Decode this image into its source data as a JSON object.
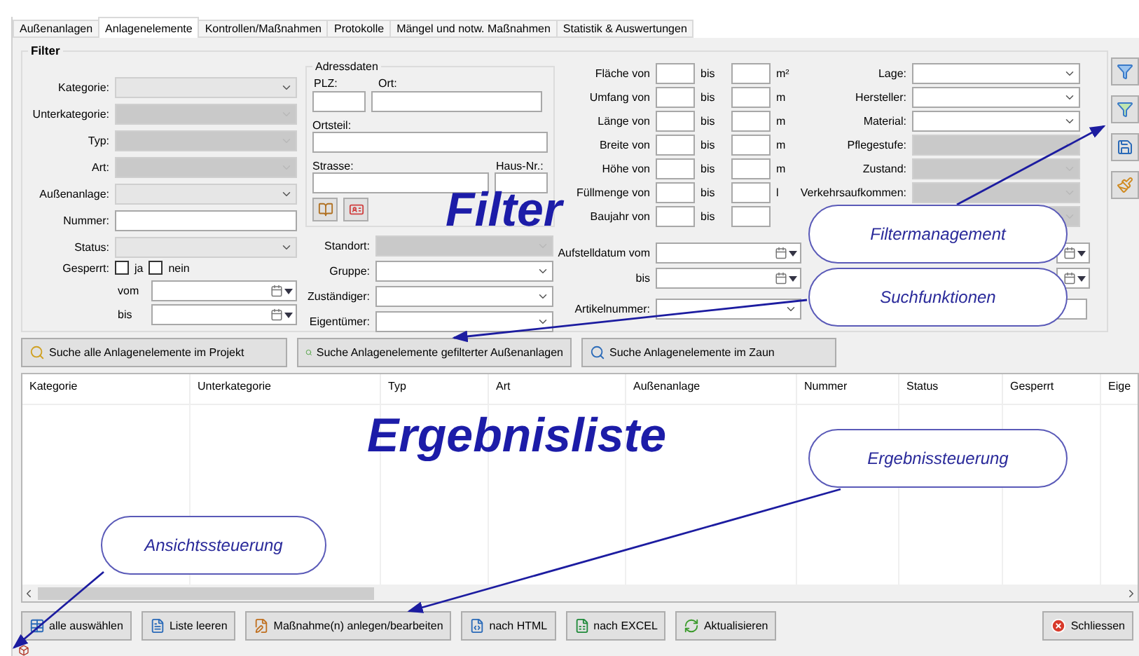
{
  "tabs": [
    {
      "label": "Außenanlagen",
      "selected": false
    },
    {
      "label": "Anlagenelemente",
      "selected": true
    },
    {
      "label": "Kontrollen/Maßnahmen",
      "selected": false
    },
    {
      "label": "Protokolle",
      "selected": false
    },
    {
      "label": "Mängel und notw. Maßnahmen",
      "selected": false
    },
    {
      "label": "Statistik & Auswertungen",
      "selected": false
    }
  ],
  "filter": {
    "title": "Filter",
    "left_fields": [
      {
        "label": "Kategorie:",
        "kind": "list",
        "disabled": false
      },
      {
        "label": "Unterkategorie:",
        "kind": "list",
        "disabled": true
      },
      {
        "label": "Typ:",
        "kind": "list",
        "disabled": true
      },
      {
        "label": "Art:",
        "kind": "list",
        "disabled": true
      },
      {
        "label": "Außenanlage:",
        "kind": "list",
        "disabled": false
      },
      {
        "label": "Nummer:",
        "kind": "text",
        "disabled": false
      },
      {
        "label": "Status:",
        "kind": "list",
        "disabled": false
      }
    ],
    "locked": {
      "label": "Gesperrt:",
      "options": [
        {
          "label": "ja",
          "checked": false
        },
        {
          "label": "nein",
          "checked": false
        }
      ]
    },
    "date_range": [
      {
        "label": "vom"
      },
      {
        "label": "bis"
      }
    ],
    "address": {
      "title": "Adressdaten",
      "plz": "PLZ:",
      "ort": "Ort:",
      "ortsteil": "Ortsteil:",
      "strasse": "Strasse:",
      "hausnr": "Haus-Nr.:"
    },
    "assignment_fields": [
      {
        "label": "Standort:",
        "kind": "list",
        "disabled": true
      },
      {
        "label": "Gruppe:",
        "kind": "combo",
        "disabled": false
      },
      {
        "label": "Zuständiger:",
        "kind": "combo",
        "disabled": false
      },
      {
        "label": "Eigentümer:",
        "kind": "combo",
        "disabled": false
      }
    ],
    "ranges": [
      {
        "label": "Fläche von",
        "to": "bis",
        "unit": "m²"
      },
      {
        "label": "Umfang von",
        "to": "bis",
        "unit": "m"
      },
      {
        "label": "Länge von",
        "to": "bis",
        "unit": "m"
      },
      {
        "label": "Breite von",
        "to": "bis",
        "unit": "m"
      },
      {
        "label": "Höhe von",
        "to": "bis",
        "unit": "m"
      },
      {
        "label": "Füllmenge von",
        "to": "bis",
        "unit": "l"
      },
      {
        "label": "Baujahr von",
        "to": "bis"
      }
    ],
    "right_fields": [
      {
        "label": "Lage:",
        "kind": "combo",
        "disabled": false
      },
      {
        "label": "Hersteller:",
        "kind": "combo",
        "disabled": false
      },
      {
        "label": "Material:",
        "kind": "combo",
        "disabled": false
      },
      {
        "label": "Pflegestufe:",
        "kind": "list",
        "disabled": true
      },
      {
        "label": "Zustand:",
        "kind": "list",
        "disabled": true
      },
      {
        "label": "Verkehrsaufkommen:",
        "kind": "list",
        "disabled": true
      },
      {
        "kind": "list",
        "disabled": true
      }
    ],
    "install_dates": [
      {
        "label": "Aufstelldatum vom"
      },
      {
        "label": "bis"
      }
    ],
    "article": {
      "label": "Artikelnummer:"
    }
  },
  "search_buttons": [
    {
      "label": "Suche alle Anlagenelemente im Projekt"
    },
    {
      "label": "Suche Anlagenelemente gefilterter Außenanlagen"
    },
    {
      "label": "Suche Anlagenelemente im Zaun"
    }
  ],
  "results": {
    "columns": [
      "Kategorie",
      "Unterkategorie",
      "Typ",
      "Art",
      "Außenanlage",
      "Nummer",
      "Status",
      "Gesperrt",
      "Eige"
    ]
  },
  "bottom_buttons": [
    {
      "label": "alle auswählen",
      "kind": "select-all"
    },
    {
      "label": "Liste leeren",
      "kind": "clear"
    },
    {
      "label": "Maßnahme(n) anlegen/bearbeiten",
      "kind": "measure"
    },
    {
      "label": "nach HTML",
      "kind": "html"
    },
    {
      "label": "nach EXCEL",
      "kind": "excel"
    },
    {
      "label": "Aktualisieren",
      "kind": "refresh"
    },
    {
      "label": "Schliessen",
      "kind": "close"
    }
  ],
  "annotations": {
    "headings": [
      "Filter",
      "Ergebnisliste"
    ],
    "callouts": [
      "Filtermanagement",
      "Suchfunktionen",
      "Ergebnissteuerung",
      "Ansichtssteuerung"
    ]
  }
}
